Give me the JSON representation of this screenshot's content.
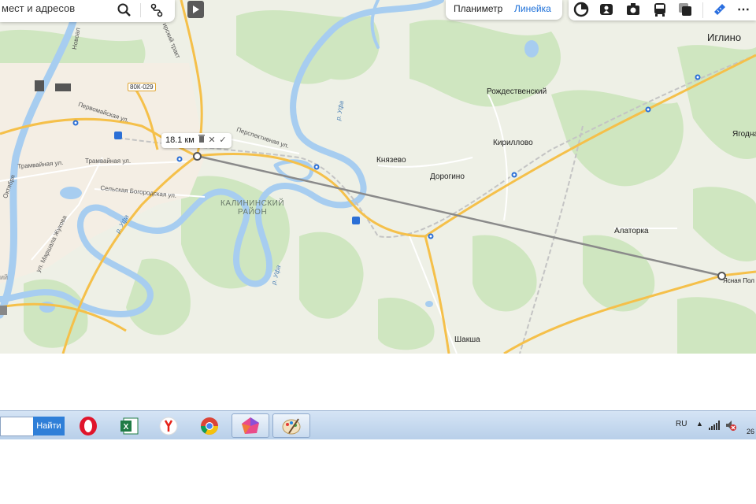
{
  "search": {
    "placeholder": "мест и адресов"
  },
  "tabs": {
    "planimeter": "Планиметр",
    "ruler": "Линейка"
  },
  "ruler": {
    "distance": "18.1 км"
  },
  "map": {
    "towns": {
      "iglino": "Иглино",
      "rozhdestvensky": "Рождественский",
      "kirillovo": "Кириллово",
      "knyazevo": "Князево",
      "dorogino": "Дорогино",
      "yagodnaya": "Ягодна",
      "alatorka": "Алаторка",
      "yasnaya_polyana": "Ясная Пол",
      "shaksha": "Шакша"
    },
    "district": [
      "КАЛИНИНСКИЙ",
      "РАЙОН"
    ],
    "road_shield": "80К-029",
    "streets": {
      "pervomayskaya": "Первомайская ул.",
      "perspektivnaya": "Перспективная ул.",
      "tramvaynaya_1": "Трамвайная ул.",
      "tramvaynaya_2": "Трамвайная ул.",
      "selskaya": "Сельская Богородская ул.",
      "zhukova": "ул. Маршала Жукова",
      "oktyabrya": "Октября",
      "trakt": "ирский тракт",
      "novoal": "Новоал",
      "street_left": "ий"
    },
    "rivers": {
      "ufa_1": "р. Уфа",
      "ufa_2": "р. Уфа",
      "ufa_3": "р. Уфа"
    },
    "colors": {
      "forest": "#cfe6c0",
      "water": "#a7cdf0",
      "road_major": "#f5c04a",
      "road_minor": "#ffffff",
      "railway": "#b8b8b8",
      "ruler_line": "#8a8a8a",
      "background": "#eef0e6"
    }
  },
  "taskbar": {
    "find_label": "Найти",
    "apps": [
      "opera-icon",
      "excel-icon",
      "yandex-browser-icon",
      "chrome-icon",
      "polygon-app-icon",
      "paint-icon"
    ],
    "lang": "RU",
    "clock_partial": "26"
  }
}
